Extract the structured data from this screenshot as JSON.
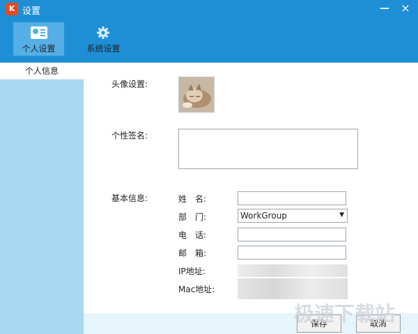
{
  "window": {
    "title": "设置",
    "app_icon_glyph": "K",
    "minimize_glyph": "—",
    "close_glyph": "×"
  },
  "nav": {
    "tabs": [
      {
        "label": "个人设置",
        "icon": "id-card-icon",
        "active": true
      },
      {
        "label": "系统设置",
        "icon": "gear-icon",
        "active": false
      }
    ]
  },
  "sidebar": {
    "items": [
      {
        "label": "个人信息",
        "active": true
      }
    ]
  },
  "form": {
    "avatar_label": "头像设置:",
    "signature_label": "个性签名:",
    "signature_value": "",
    "basic_info_label": "基本信息:",
    "name_label": "姓　名:",
    "name_value": "",
    "department_label": "部　门:",
    "department_value": "WorkGroup",
    "phone_label": "电　话:",
    "phone_value": "",
    "email_label": "邮　箱:",
    "email_value": "",
    "ip_label": "IP地址:",
    "mac_label": "Mac地址:"
  },
  "buttons": {
    "save": "保存",
    "cancel": "取消"
  },
  "watermark": "极速下载站",
  "colors": {
    "header": "#1e8fd6",
    "active_tab": "#55aee6",
    "sidebar": "#a9d8f2"
  }
}
